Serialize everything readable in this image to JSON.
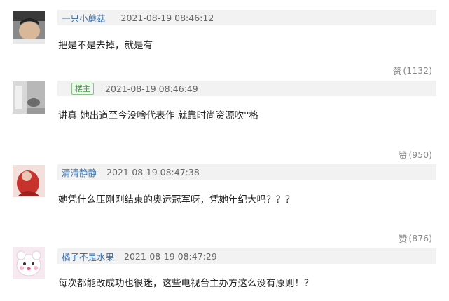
{
  "comments": [
    {
      "username": "一只小蘑菇",
      "badge": "",
      "time": "2021-08-19 08:46:12",
      "text": "把是不是去掉，就是有",
      "likes_label": "赞",
      "likes": "(1132)"
    },
    {
      "username": "",
      "badge": "楼主",
      "time": "2021-08-19 08:46:49",
      "text": "讲真 她出道至今没啥代表作 就靠时尚资源吹''格",
      "likes_label": "赞",
      "likes": "(950)"
    },
    {
      "username": "清清静静",
      "badge": "",
      "time": "2021-08-19 08:47:38",
      "text": "她凭什么压刚刚结束的奥运冠军呀，凭她年纪大吗？？？",
      "likes_label": "赞",
      "likes": "(876)"
    },
    {
      "username": "橘子不是水果",
      "badge": "",
      "time": "2021-08-19 08:47:29",
      "text": "每次都能改成功也很迷，这些电视台主办方这么没有原则！？",
      "likes_label": "",
      "likes": ""
    }
  ]
}
